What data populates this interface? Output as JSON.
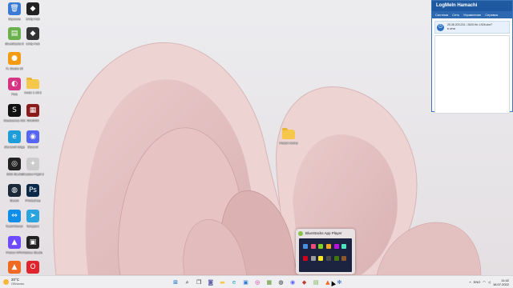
{
  "desktop": {
    "icons": [
      {
        "label": "Корзина",
        "color": "#3a7bd5",
        "glyph": "🗑"
      },
      {
        "label": "Unity Hub",
        "color": "#222222",
        "glyph": "◆"
      },
      {
        "label": "BlueStacks 5",
        "color": "#6ab04c",
        "glyph": "▤"
      },
      {
        "label": "Unity Hub",
        "color": "#333333",
        "glyph": "◆"
      },
      {
        "label": "FL Studio 20",
        "color": "#f39c12",
        "glyph": "●"
      },
      {
        "label": "Pixie",
        "color": "#d63384",
        "glyph": "◐"
      },
      {
        "label": "mods 1.19.2",
        "color": "#f5c84c",
        "glyph": "folder"
      },
      {
        "label": "Steelseries GG",
        "color": "#111111",
        "glyph": "S"
      },
      {
        "label": "WinRAR",
        "color": "#8b1a1a",
        "glyph": "▦"
      },
      {
        "label": "Microsoft Edge",
        "color": "#1f9dd8",
        "glyph": "e"
      },
      {
        "label": "Discord",
        "color": "#5865f2",
        "glyph": "◉"
      },
      {
        "label": "OBS Studio",
        "color": "#222222",
        "glyph": "◎"
      },
      {
        "label": "Shadow Fight 3",
        "color": "#cccccc",
        "glyph": "✦"
      },
      {
        "label": "Steam",
        "color": "#1b2838",
        "glyph": "◍"
      },
      {
        "label": "Photoshop",
        "color": "#0b2a4a",
        "glyph": "Ps"
      },
      {
        "label": "TeamViewer",
        "color": "#0e8ee9",
        "glyph": "⇔"
      },
      {
        "label": "Telegram",
        "color": "#2aa3de",
        "glyph": "➤"
      },
      {
        "label": "Proton VPN",
        "color": "#6d4aff",
        "glyph": "▲"
      },
      {
        "label": "Roblox Studio",
        "color": "#222222",
        "glyph": "▣"
      },
      {
        "label": "Hamachi",
        "color": "#f16a24",
        "glyph": "▲"
      },
      {
        "label": "Opera",
        "color": "#e0242c",
        "glyph": "O"
      }
    ],
    "center_folder": {
      "label": "Новая папка"
    }
  },
  "hamachi": {
    "title": "LogMeIn Hamachi",
    "menu": [
      "Система",
      "Сеть",
      "Управление",
      "Справка"
    ],
    "network_ip": "25.38.203.231 / 2620:9b::1926:cbe7",
    "network_status": "в сети"
  },
  "bluestacks_preview": {
    "title": "BlueStacks App Player"
  },
  "taskbar": {
    "weather_temp": "20°C",
    "weather_desc": "Облачно",
    "apps": [
      {
        "name": "start",
        "glyph": "⊞",
        "color": "#0067c0"
      },
      {
        "name": "search",
        "glyph": "⌕",
        "color": "#222222"
      },
      {
        "name": "task-view",
        "glyph": "❐",
        "color": "#222222"
      },
      {
        "name": "chat",
        "glyph": "◙",
        "color": "#6264a7"
      },
      {
        "name": "explorer",
        "glyph": "▬",
        "color": "#f5c84c"
      },
      {
        "name": "edge",
        "glyph": "e",
        "color": "#1f9dd8"
      },
      {
        "name": "store",
        "glyph": "▣",
        "color": "#2d7cd6"
      },
      {
        "name": "instagram",
        "glyph": "◎",
        "color": "#d6249f"
      },
      {
        "name": "minecraft",
        "glyph": "▦",
        "color": "#5a8f29"
      },
      {
        "name": "steam",
        "glyph": "◍",
        "color": "#1b2838"
      },
      {
        "name": "discord",
        "glyph": "◉",
        "color": "#5865f2"
      },
      {
        "name": "app-red",
        "glyph": "◆",
        "color": "#c0392b"
      },
      {
        "name": "bluestacks",
        "glyph": "▤",
        "color": "#6ab04c"
      },
      {
        "name": "hamachi",
        "glyph": "▲",
        "color": "#f16a24"
      },
      {
        "name": "settings",
        "glyph": "✻",
        "color": "#2f6fb3"
      }
    ],
    "tray_lang": "ENG",
    "time": "11:42",
    "date": "18.07.2022"
  }
}
